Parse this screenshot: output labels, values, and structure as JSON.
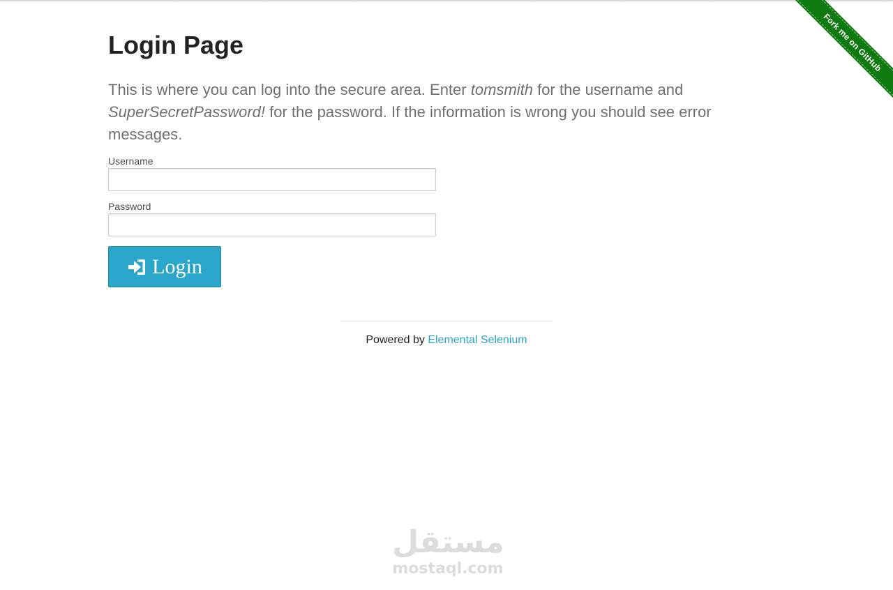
{
  "ribbon": {
    "label": "Fork me on GitHub",
    "color": "#0f7a10"
  },
  "page": {
    "title": "Login Page",
    "intro": {
      "part1": "This is where you can log into the secure area. Enter ",
      "username_hint": "tomsmith",
      "part2": " for the username and ",
      "password_hint": "SuperSecretPassword!",
      "part3": " for the password. If the information is wrong you should see error messages."
    }
  },
  "form": {
    "username_label": "Username",
    "username_value": "",
    "password_label": "Password",
    "password_value": "",
    "submit_label": "Login",
    "submit_icon": "sign-in-icon",
    "button_color": "#2ba6cb"
  },
  "footer": {
    "prefix": "Powered by ",
    "link_text": "Elemental Selenium",
    "link_color": "#2ba6cb"
  },
  "watermark": {
    "arabic": "مستقل",
    "latin": "mostaql.com"
  }
}
